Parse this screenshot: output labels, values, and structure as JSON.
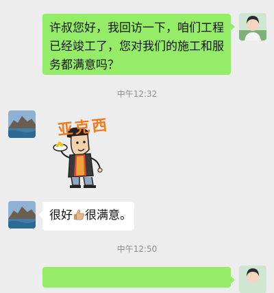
{
  "messages": [
    {
      "side": "right",
      "text": "许叔您好，我回访一下，咱们工程已经竣工了，您对我们的施工和服务都满意吗？"
    },
    {
      "type": "time",
      "text": "中午12:32"
    },
    {
      "side": "left",
      "type": "sticker",
      "sticker_text": "亚克西"
    },
    {
      "side": "left",
      "text_before": "很好",
      "emoji": "thumbs-up",
      "text_after": "很满意。"
    },
    {
      "type": "time",
      "text": "中午12:50"
    }
  ],
  "colors": {
    "background": "#ededed",
    "sent_bubble": "#95ec69",
    "received_bubble": "#ffffff",
    "timestamp": "#8c8c8c",
    "sticker_text": "#f07a20"
  }
}
